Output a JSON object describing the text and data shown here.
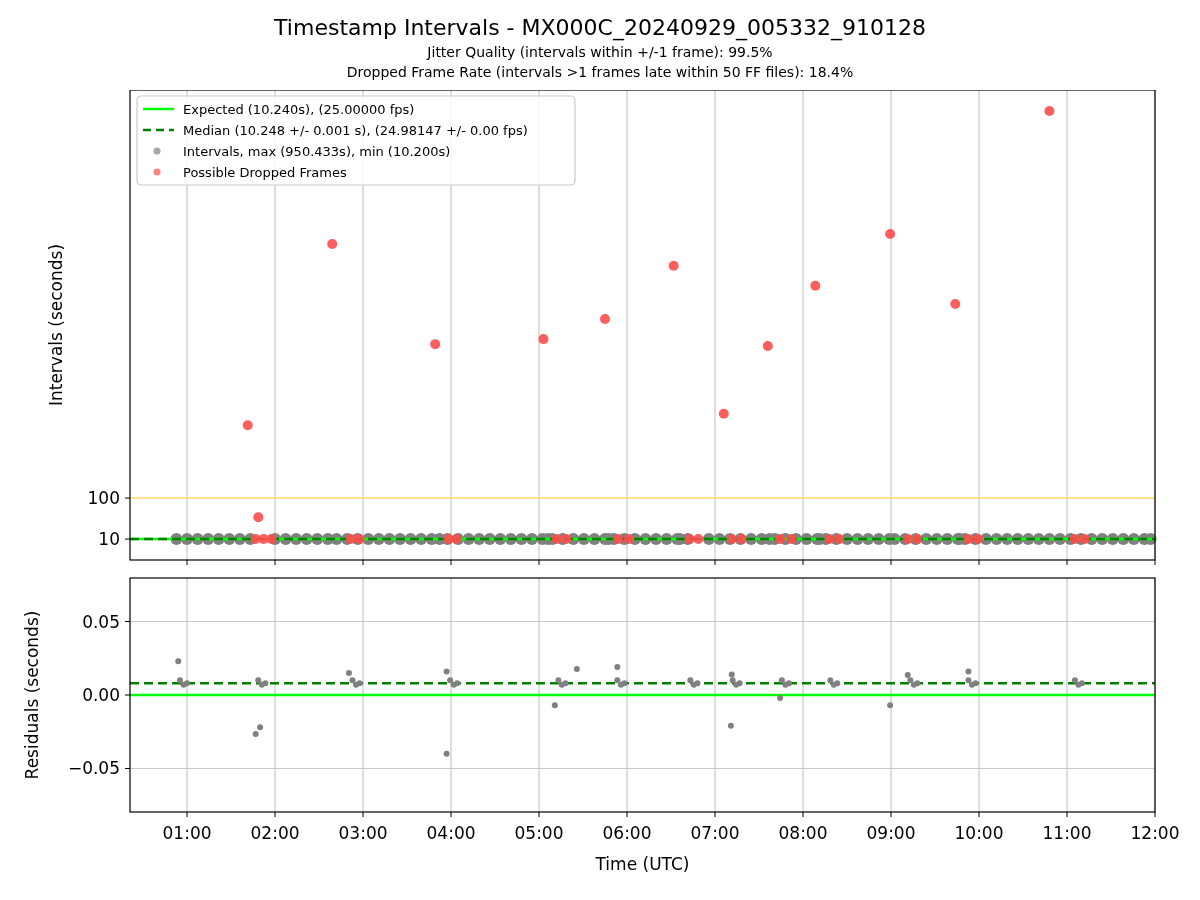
{
  "figure": {
    "title": "Timestamp Intervals - MX000C_20240929_005332_910128",
    "subtitles": [
      "Jitter Quality (intervals within +/-1 frame): 99.5%",
      "Dropped Frame Rate (intervals >1 frames late within 50 FF files): 18.4%"
    ]
  },
  "intervals_plot": {
    "chart_data": {
      "type": "scatter",
      "ylabel": "Intervals (seconds)",
      "xlim": [
        0.352,
        12.0
      ],
      "ylim": [
        -36,
        996
      ],
      "grid": true,
      "legend": "upper left",
      "yticks": [
        {
          "value": 10,
          "label": "10"
        },
        {
          "value": 100,
          "label": "100"
        }
      ],
      "series": [
        {
          "type": "scatter",
          "name": "Intervals, max (950.433s), min (10.200s)",
          "color": "#808080",
          "x": [
            0.88,
            1.0,
            1.12,
            1.24,
            1.36,
            1.48,
            1.6,
            1.72,
            2.0,
            2.12,
            2.24,
            2.36,
            2.48,
            2.6,
            2.7,
            2.82,
            2.94,
            3.06,
            3.18,
            3.3,
            3.42,
            3.54,
            3.66,
            3.78,
            3.87,
            3.96,
            4.08,
            4.2,
            4.32,
            4.44,
            4.56,
            4.68,
            4.8,
            4.92,
            5.04,
            5.1,
            5.15,
            5.27,
            5.39,
            5.51,
            5.63,
            5.75,
            5.79,
            5.85,
            5.97,
            6.09,
            6.21,
            6.33,
            6.45,
            6.57,
            6.6,
            6.69,
            6.93,
            7.05,
            7.17,
            7.29,
            7.41,
            7.53,
            7.62,
            7.68,
            7.8,
            7.92,
            8.04,
            8.16,
            8.19,
            8.26,
            8.38,
            8.5,
            8.62,
            8.74,
            8.86,
            8.98,
            9.04,
            9.16,
            9.28,
            9.4,
            9.52,
            9.64,
            9.76,
            9.78,
            9.84,
            9.96,
            10.08,
            10.2,
            10.32,
            10.44,
            10.56,
            10.68,
            10.8,
            10.92,
            11.04,
            11.16,
            11.28,
            11.4,
            11.52,
            11.64,
            11.76,
            11.88,
            11.95
          ],
          "values": [
            10,
            10,
            10,
            10,
            10,
            10,
            10,
            10,
            10,
            10,
            10,
            10,
            10,
            10,
            10,
            10,
            10,
            10,
            10,
            10,
            10,
            10,
            10,
            10,
            10,
            10,
            10,
            10,
            10,
            10,
            10,
            10,
            10,
            10,
            10,
            10,
            10,
            10,
            10,
            10,
            10,
            10,
            10,
            10,
            10,
            10,
            10,
            10,
            10,
            10,
            10,
            10,
            10,
            10,
            10,
            10,
            10,
            10,
            10,
            10,
            10,
            10,
            10,
            10,
            10,
            10,
            10,
            10,
            10,
            10,
            10,
            10,
            10,
            10,
            10,
            10,
            10,
            10,
            10,
            10,
            10,
            10,
            10,
            10,
            10,
            10,
            10,
            10,
            10,
            10,
            10,
            10,
            10,
            10,
            10,
            10,
            10,
            10,
            10
          ]
        },
        {
          "type": "line",
          "color": "#ffd966",
          "line_style": "solid",
          "x": [
            0.352,
            12.0
          ],
          "values": [
            100,
            100
          ]
        },
        {
          "type": "line",
          "name": "Expected (10.240s), (25.00000 fps)",
          "color": "#00ff00",
          "line_style": "solid",
          "x": [
            0.352,
            12.0
          ],
          "values": [
            10,
            10
          ]
        },
        {
          "type": "line",
          "name": "Median (10.248 +/- 0.001 s), (24.98147 +/- 0.00 fps)",
          "color": "#007f00",
          "line_style": "dashed",
          "x": [
            0.352,
            12.0
          ],
          "values": [
            10,
            10
          ]
        },
        {
          "type": "scatter",
          "name": "Possible Dropped Frames",
          "color": "#ff4d4d",
          "x": [
            1.69,
            1.81,
            2.65,
            3.82,
            5.05,
            5.75,
            6.53,
            7.1,
            7.6,
            8.14,
            8.99,
            9.73,
            10.8,
            1.78,
            1.87,
            1.96,
            2.86,
            2.96,
            3.97,
            4.06,
            5.2,
            5.31,
            5.9,
            6.02,
            6.71,
            6.81,
            7.19,
            7.3,
            7.74,
            7.87,
            8.3,
            8.41,
            9.19,
            9.3,
            9.88,
            9.99,
            11.09,
            11.2
          ],
          "values": [
            260,
            58,
            658,
            438,
            449,
            493,
            610,
            285,
            434,
            566,
            680,
            526,
            950,
            10,
            10,
            10,
            10,
            10,
            10,
            10,
            10,
            10,
            10,
            10,
            10,
            10,
            10,
            10,
            10,
            10,
            10,
            10,
            10,
            10,
            10,
            10,
            10,
            10
          ]
        }
      ]
    }
  },
  "residuals_plot": {
    "chart_data": {
      "type": "scatter",
      "xlabel": "Time (UTC)",
      "ylabel": "Residuals (seconds)",
      "xlim": [
        0.352,
        12.0
      ],
      "ylim": [
        -0.0796,
        0.0796
      ],
      "grid": true,
      "xticks": [
        {
          "value": 1,
          "label": "01:00"
        },
        {
          "value": 2,
          "label": "02:00"
        },
        {
          "value": 3,
          "label": "03:00"
        },
        {
          "value": 4,
          "label": "04:00"
        },
        {
          "value": 5,
          "label": "05:00"
        },
        {
          "value": 6,
          "label": "06:00"
        },
        {
          "value": 7,
          "label": "07:00"
        },
        {
          "value": 8,
          "label": "08:00"
        },
        {
          "value": 9,
          "label": "09:00"
        },
        {
          "value": 10,
          "label": "10:00"
        },
        {
          "value": 11,
          "label": "11:00"
        },
        {
          "value": 12,
          "label": "12:00"
        }
      ],
      "yticks": [
        {
          "value": -0.05,
          "label": "−0.05"
        },
        {
          "value": 0,
          "label": "0.00"
        },
        {
          "value": 0.05,
          "label": "0.05"
        }
      ],
      "series": [
        {
          "type": "line",
          "color": "#00ff00",
          "line_style": "solid",
          "x": [
            0.352,
            12.0
          ],
          "values": [
            0,
            0
          ]
        },
        {
          "type": "line",
          "color": "#007f00",
          "line_style": "dashed",
          "x": [
            0.352,
            12.0
          ],
          "values": [
            0.008,
            0.008
          ]
        },
        {
          "type": "scatter",
          "color": "#808080",
          "x": [
            0.9,
            1.78,
            1.83,
            2.84,
            3.95,
            3.95,
            5.18,
            5.43,
            5.89,
            7.18,
            7.19,
            7.74,
            8.99,
            9.19,
            9.88,
            0.92,
            0.96,
            1.0,
            1.81,
            1.85,
            1.89,
            2.88,
            2.92,
            2.96,
            3.99,
            4.03,
            4.07,
            5.22,
            5.26,
            5.3,
            5.89,
            5.93,
            5.97,
            6.72,
            6.76,
            6.8,
            7.2,
            7.24,
            7.28,
            7.76,
            7.8,
            7.84,
            8.31,
            8.35,
            8.39,
            9.22,
            9.26,
            9.3,
            9.88,
            9.92,
            9.96,
            11.09,
            11.13,
            11.17
          ],
          "values": [
            0.023,
            -0.0265,
            -0.022,
            0.015,
            0.016,
            -0.04,
            -0.007,
            0.0177,
            0.019,
            -0.021,
            0.014,
            -0.002,
            -0.007,
            0.0136,
            0.016,
            0.01,
            0.007,
            0.008,
            0.01,
            0.007,
            0.008,
            0.01,
            0.007,
            0.008,
            0.01,
            0.007,
            0.008,
            0.01,
            0.007,
            0.008,
            0.01,
            0.007,
            0.008,
            0.01,
            0.007,
            0.008,
            0.01,
            0.007,
            0.008,
            0.01,
            0.007,
            0.008,
            0.01,
            0.007,
            0.008,
            0.01,
            0.007,
            0.008,
            0.01,
            0.007,
            0.008,
            0.01,
            0.007,
            0.008
          ]
        }
      ]
    }
  }
}
